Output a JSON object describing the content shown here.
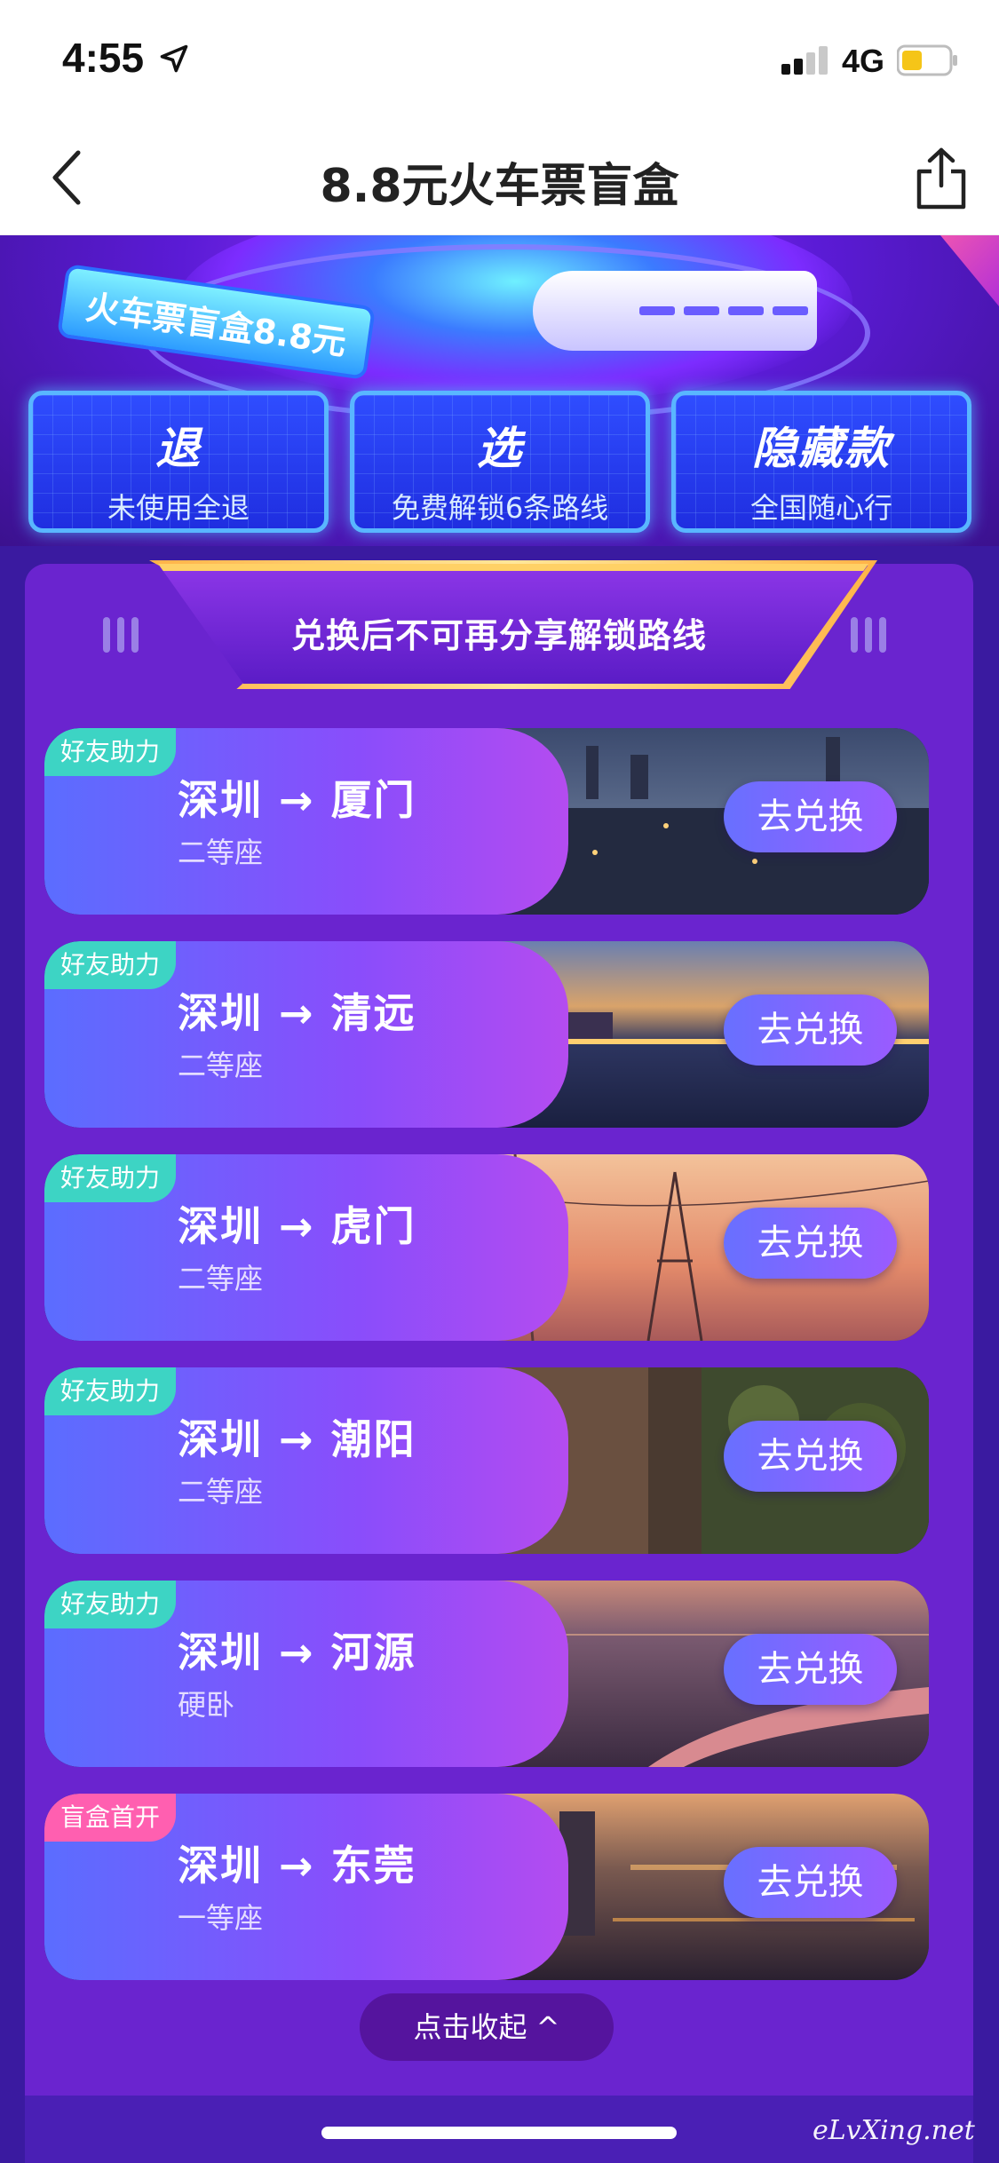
{
  "status_bar": {
    "time": "4:55",
    "network": "4G",
    "location_icon": "location-arrow-icon",
    "battery_color": "#f5c518"
  },
  "nav": {
    "title": "8.8元火车票盲盒",
    "back_icon": "chevron-left-icon",
    "share_icon": "share-icon"
  },
  "hero": {
    "badge": "火车票盲盒8.8元",
    "features": [
      {
        "title": "退",
        "subtitle": "未使用全退"
      },
      {
        "title": "选",
        "subtitle": "免费解锁6条路线"
      },
      {
        "title": "隐藏款",
        "subtitle": "全国随心行"
      }
    ]
  },
  "panel": {
    "banner_text": "兑换后不可再分享解锁路线",
    "routes": [
      {
        "tag": "好友助力",
        "route": "深圳 → 厦门",
        "seat": "二等座",
        "button": "去兑换"
      },
      {
        "tag": "好友助力",
        "route": "深圳 → 清远",
        "seat": "二等座",
        "button": "去兑换"
      },
      {
        "tag": "好友助力",
        "route": "深圳 → 虎门",
        "seat": "二等座",
        "button": "去兑换"
      },
      {
        "tag": "好友助力",
        "route": "深圳 → 潮阳",
        "seat": "二等座",
        "button": "去兑换"
      },
      {
        "tag": "好友助力",
        "route": "深圳 → 河源",
        "seat": "硬卧",
        "button": "去兑换"
      },
      {
        "tag": "盲盒首开",
        "route": "深圳 → 东莞",
        "seat": "一等座",
        "button": "去兑换"
      }
    ],
    "collapse_label": "点击收起 ^"
  },
  "watermark": "eLvXing.net",
  "colors": {
    "tag_teal": "#3dd4c4",
    "tag_pink": "#ff5fb0",
    "panel_bg": "#6a24cf"
  }
}
